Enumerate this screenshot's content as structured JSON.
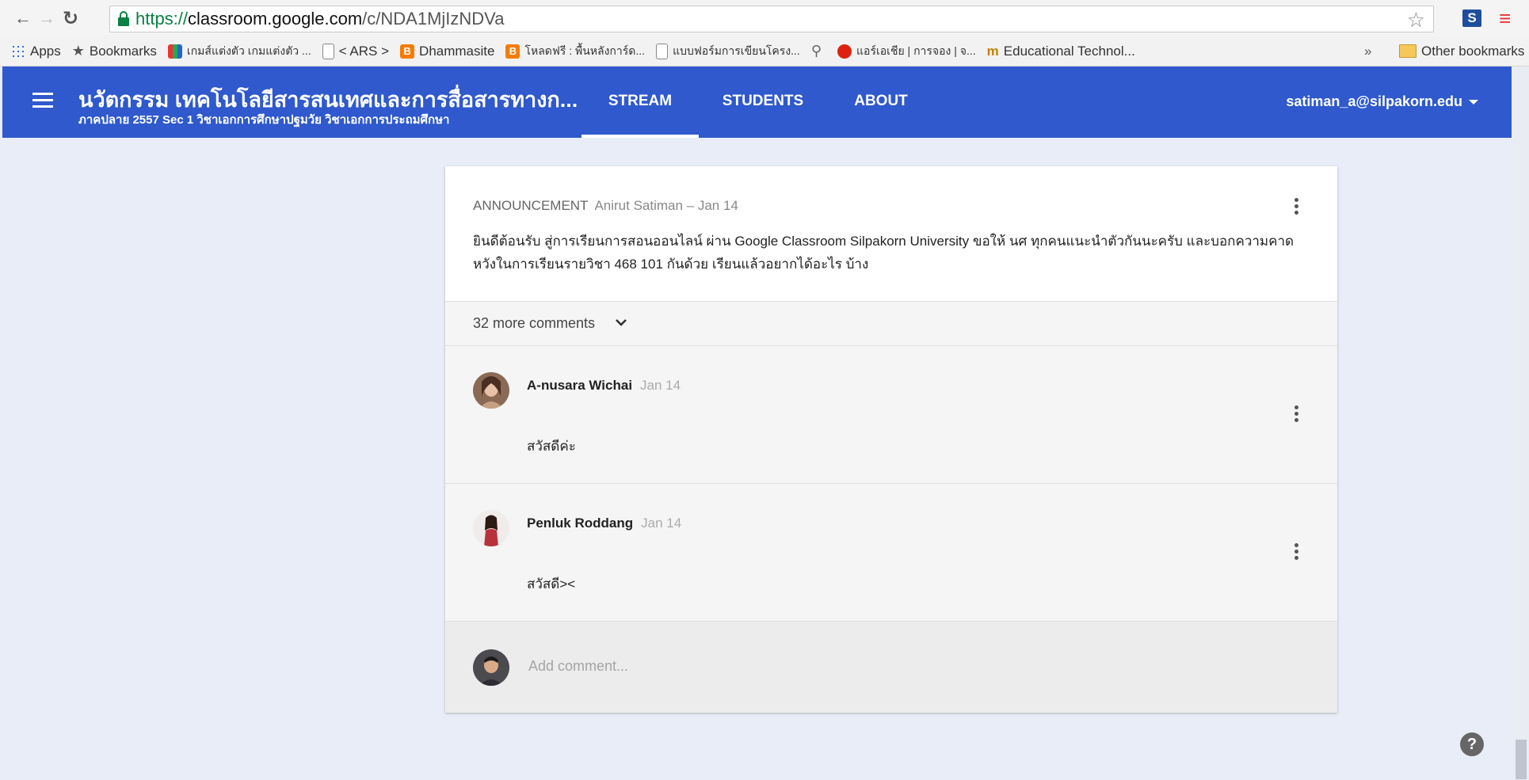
{
  "browser": {
    "url_scheme": "https://",
    "url_host": "classroom.google.com",
    "url_path": "/c/NDA1MjIzNDVa",
    "bookmarks": [
      {
        "label": "Apps",
        "icon": "apps-grid-icon"
      },
      {
        "label": "Bookmarks",
        "icon": "star-icon"
      },
      {
        "label": "เกมส์แต่งตัว เกมแต่งตัว ...",
        "icon": "colorful-icon"
      },
      {
        "label": "< ARS >",
        "icon": "document-icon"
      },
      {
        "label": "Dhammasite",
        "icon": "blogger-icon"
      },
      {
        "label": "โหลดฟรี : พื้นหลังการ์ด...",
        "icon": "blogger-icon"
      },
      {
        "label": "แบบฟอร์มการเขียนโครง...",
        "icon": "document-icon"
      },
      {
        "label": "",
        "icon": "search-icon"
      },
      {
        "label": "แอร์เอเชีย | การจอง | จ...",
        "icon": "airasia-icon"
      },
      {
        "label": "Educational Technol...",
        "icon": "edu-icon"
      }
    ],
    "more_bookmarks": "»",
    "other_bookmarks": "Other bookmarks"
  },
  "header": {
    "class_title": "นวัตกรรม เทคโนโลยีสารสนเทศและการสื่อสารทางก...",
    "class_subtitle": "ภาคปลาย 2557 Sec 1 วิชาเอกการศึกษาปฐมวัย วิชาเอกการประถมศึกษา",
    "tabs": [
      {
        "label": "STREAM",
        "active": true
      },
      {
        "label": "STUDENTS",
        "active": false
      },
      {
        "label": "ABOUT",
        "active": false
      }
    ],
    "user_email": "satiman_a@silpakorn.edu"
  },
  "post": {
    "type_label": "ANNOUNCEMENT",
    "author_date": "Anirut Satiman – Jan 14",
    "body_line1": "ยินดีต้อนรับ สู่การเรียนการสอนออนไลน์ ผ่าน Google Classroom Silpakorn University ขอให้ นศ ทุกคนแนะนำตัวกันนะครับ และบอกความคาด",
    "body_line2": "หวังในการเรียนรายวิชา 468 101 กันด้วย เรียนแล้วอยากได้อะไร บ้าง"
  },
  "comments_toggle": "32 more comments",
  "comments": [
    {
      "name": "A-nusara Wichai",
      "date": "Jan 14",
      "text": "สวัสดีค่ะ"
    },
    {
      "name": "Penluk Roddang",
      "date": "Jan 14",
      "text": "สวัสดี><"
    }
  ],
  "add_comment_placeholder": "Add comment...",
  "help_label": "?",
  "colors": {
    "header_blue": "#2f59cc",
    "page_bg": "#e8edf7"
  }
}
